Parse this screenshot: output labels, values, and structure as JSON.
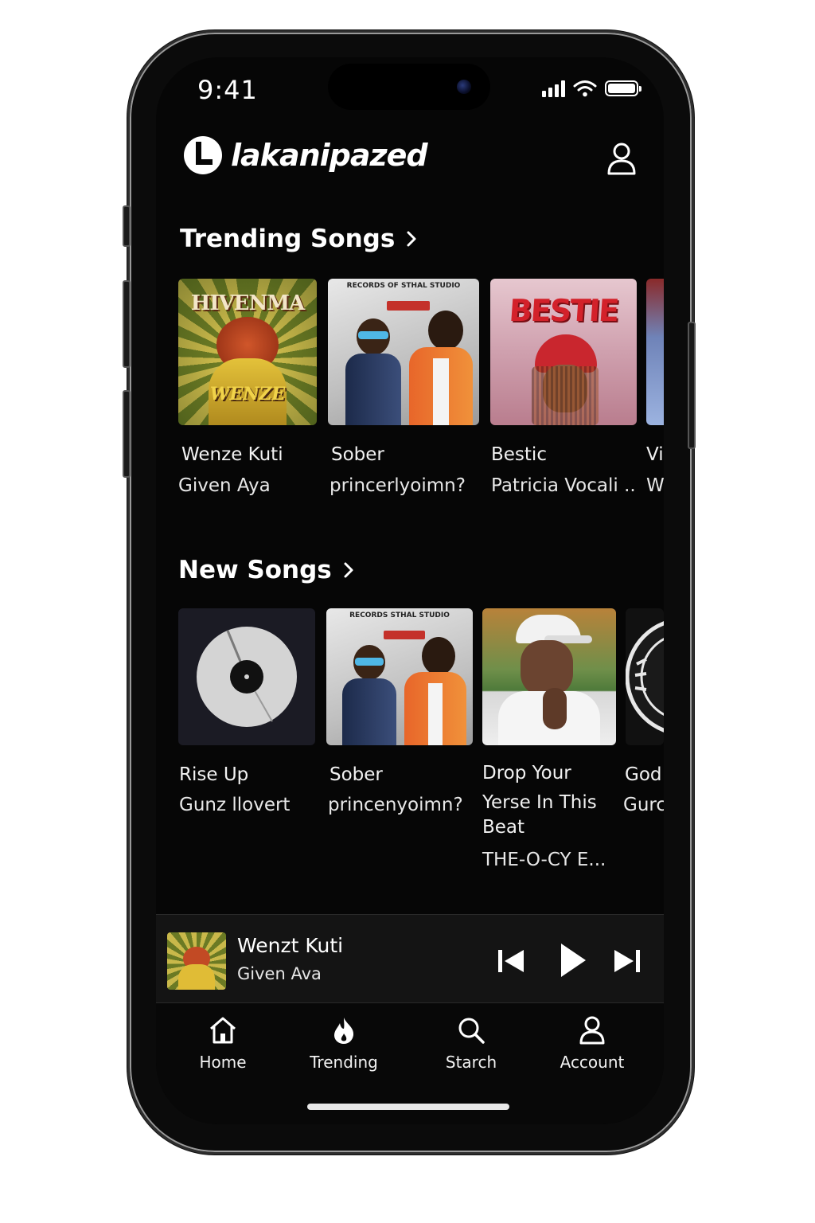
{
  "status_bar": {
    "time": "9:41"
  },
  "header": {
    "brand": "lakanipazed",
    "profile_icon": "person-icon"
  },
  "trending": {
    "title": "Trending Songs",
    "items": [
      {
        "title": "Wenze Kuti",
        "artist": "Given Aya",
        "art_text": "HIVENMA",
        "art_sub": "WENZE",
        "palette": "green-sunburst"
      },
      {
        "title": "Sober",
        "artist": "princerlyoimn?",
        "art_text": "RECORDS OF STHAL STUDIO",
        "palette": "duo-grey"
      },
      {
        "title": "Bestic",
        "artist": "Patricia Vocali ..",
        "art_text": "BESTIE",
        "palette": "pink"
      },
      {
        "title": "Vi",
        "artist": "W",
        "palette": "blue-partial"
      }
    ]
  },
  "new_songs": {
    "title": "New Songs",
    "items": [
      {
        "title": "Rise Up",
        "artist": "Gunz llovert",
        "palette": "vinyl"
      },
      {
        "title": "Sober",
        "artist": "princenyoimn?",
        "art_text": "RECORDS STHAL STUDIO",
        "palette": "duo-grey"
      },
      {
        "title": "Drop Your Yerse In This Beat",
        "title_lines": [
          "Drop Your",
          "Yerse In This",
          "Beat"
        ],
        "artist": "THE-O-CY E...",
        "palette": "man-cap"
      },
      {
        "title": "God",
        "artist": "Gurc",
        "palette": "dark-disc"
      }
    ]
  },
  "now_playing": {
    "title": "Wenzt Kuti",
    "artist": "Given Ava",
    "controls": [
      "previous-icon",
      "play-icon",
      "next-icon"
    ]
  },
  "tabs": [
    {
      "label": "Home",
      "icon": "home-icon"
    },
    {
      "label": "Trending",
      "icon": "flame-icon"
    },
    {
      "label": "Starch",
      "icon": "search-icon"
    },
    {
      "label": "Account",
      "icon": "account-icon"
    }
  ],
  "colors": {
    "background": "#060606",
    "text": "#ffffff",
    "mini_player": "#141414"
  }
}
